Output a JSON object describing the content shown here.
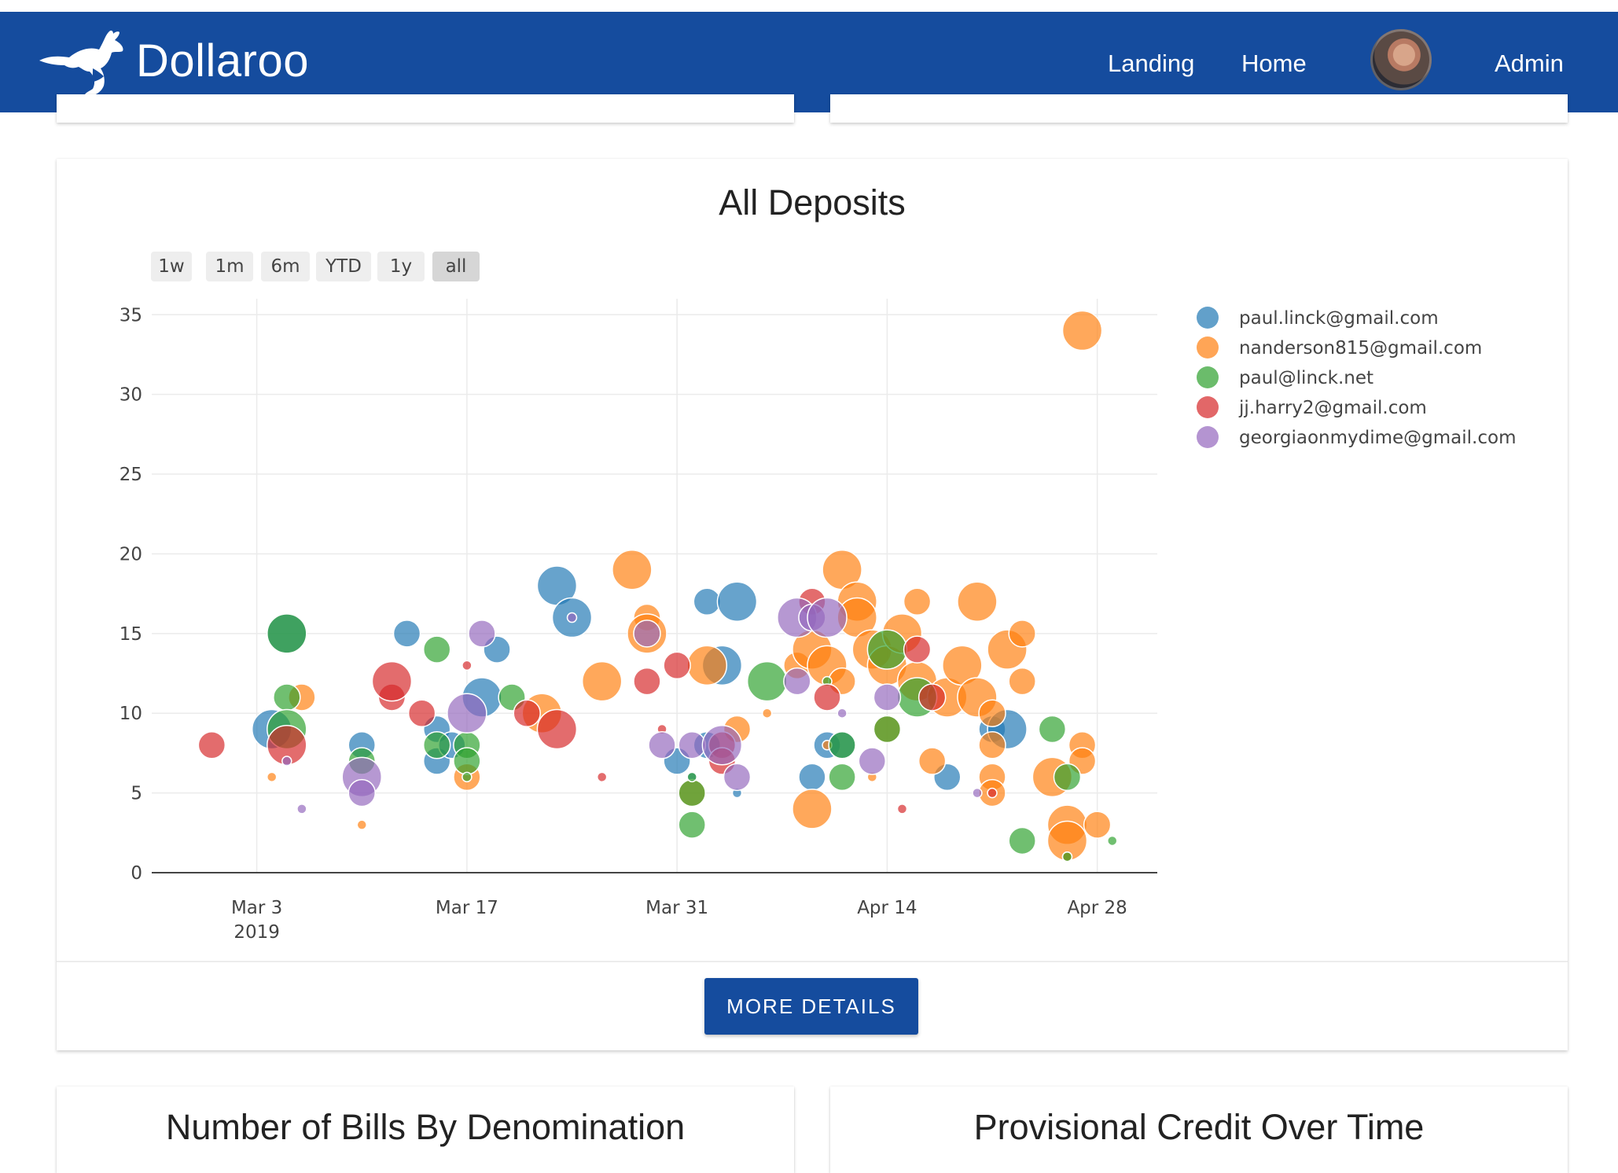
{
  "app": {
    "brand": "Dollaroo"
  },
  "nav": {
    "links": [
      "Landing",
      "Home",
      "Admin"
    ]
  },
  "main": {
    "title": "All Deposits",
    "range_buttons": [
      "1w",
      "1m",
      "6m",
      "YTD",
      "1y",
      "all"
    ],
    "active_range": "all",
    "more_details": "MORE DETAILS"
  },
  "bottom": {
    "left_title": "Number of Bills By Denomination",
    "right_title": "Provisional Credit Over Time"
  },
  "colors": {
    "navbar": "#154c9e",
    "series": [
      "#1f77b4",
      "#ff7f0e",
      "#2ca02c",
      "#d62728",
      "#9467bd"
    ]
  },
  "chart_data": {
    "type": "scatter",
    "title": "All Deposits",
    "xlabel": "",
    "ylabel": "",
    "x_range": [
      "2019-02-24",
      "2019-05-02"
    ],
    "ylim": [
      0,
      36
    ],
    "y_ticks": [
      0,
      5,
      10,
      15,
      20,
      25,
      30,
      35
    ],
    "x_ticks": [
      {
        "date": "2019-03-03",
        "label": "Mar 3",
        "sublabel": "2019"
      },
      {
        "date": "2019-03-17",
        "label": "Mar 17"
      },
      {
        "date": "2019-03-31",
        "label": "Mar 31"
      },
      {
        "date": "2019-04-14",
        "label": "Apr 14"
      },
      {
        "date": "2019-04-28",
        "label": "Apr 28"
      }
    ],
    "grid": true,
    "legend_position": "top-right",
    "series": [
      {
        "name": "paul.linck@gmail.com",
        "color": "#1f77b4",
        "points": [
          [
            "2019-03-04",
            9
          ],
          [
            "2019-03-05",
            15
          ],
          [
            "2019-03-10",
            8
          ],
          [
            "2019-03-13",
            15
          ],
          [
            "2019-03-15",
            7
          ],
          [
            "2019-03-15",
            9
          ],
          [
            "2019-03-16",
            8
          ],
          [
            "2019-03-18",
            11
          ],
          [
            "2019-03-19",
            14
          ],
          [
            "2019-03-23",
            18
          ],
          [
            "2019-03-24",
            16
          ],
          [
            "2019-03-31",
            7
          ],
          [
            "2019-04-01",
            6
          ],
          [
            "2019-04-02",
            17
          ],
          [
            "2019-04-02",
            8
          ],
          [
            "2019-04-03",
            13
          ],
          [
            "2019-04-04",
            17
          ],
          [
            "2019-04-04",
            5
          ],
          [
            "2019-04-09",
            6
          ],
          [
            "2019-04-10",
            8
          ],
          [
            "2019-04-11",
            8
          ],
          [
            "2019-04-18",
            6
          ],
          [
            "2019-04-21",
            9
          ],
          [
            "2019-04-22",
            9
          ]
        ],
        "sizes": [
          3,
          3,
          2,
          2,
          2,
          2,
          2,
          3,
          2,
          3,
          3,
          2,
          1,
          2,
          2,
          3,
          3,
          1,
          2,
          2,
          2,
          2,
          2,
          3
        ]
      },
      {
        "name": "nanderson815@gmail.com",
        "color": "#ff7f0e",
        "points": [
          [
            "2019-03-04",
            6
          ],
          [
            "2019-03-06",
            11
          ],
          [
            "2019-03-10",
            3
          ],
          [
            "2019-03-17",
            6
          ],
          [
            "2019-03-22",
            10
          ],
          [
            "2019-03-26",
            12
          ],
          [
            "2019-03-28",
            19
          ],
          [
            "2019-03-29",
            16
          ],
          [
            "2019-03-29",
            15
          ],
          [
            "2019-04-01",
            5
          ],
          [
            "2019-04-02",
            13
          ],
          [
            "2019-04-04",
            9
          ],
          [
            "2019-04-06",
            10
          ],
          [
            "2019-04-08",
            13
          ],
          [
            "2019-04-09",
            14
          ],
          [
            "2019-04-09",
            4
          ],
          [
            "2019-04-10",
            8
          ],
          [
            "2019-04-10",
            13
          ],
          [
            "2019-04-11",
            19
          ],
          [
            "2019-04-11",
            12
          ],
          [
            "2019-04-12",
            17
          ],
          [
            "2019-04-12",
            16
          ],
          [
            "2019-04-13",
            14
          ],
          [
            "2019-04-13",
            6
          ],
          [
            "2019-04-14",
            13
          ],
          [
            "2019-04-14",
            9
          ],
          [
            "2019-04-15",
            15
          ],
          [
            "2019-04-16",
            17
          ],
          [
            "2019-04-16",
            12
          ],
          [
            "2019-04-17",
            7
          ],
          [
            "2019-04-18",
            11
          ],
          [
            "2019-04-19",
            13
          ],
          [
            "2019-04-20",
            17
          ],
          [
            "2019-04-20",
            11
          ],
          [
            "2019-04-21",
            10
          ],
          [
            "2019-04-21",
            8
          ],
          [
            "2019-04-21",
            6
          ],
          [
            "2019-04-21",
            5
          ],
          [
            "2019-04-22",
            14
          ],
          [
            "2019-04-23",
            15
          ],
          [
            "2019-04-23",
            12
          ],
          [
            "2019-04-25",
            6
          ],
          [
            "2019-04-26",
            3
          ],
          [
            "2019-04-26",
            2
          ],
          [
            "2019-04-26",
            1
          ],
          [
            "2019-04-27",
            8
          ],
          [
            "2019-04-27",
            7
          ],
          [
            "2019-04-27",
            34
          ],
          [
            "2019-04-28",
            3
          ]
        ],
        "sizes": [
          1,
          2,
          1,
          2,
          3,
          3,
          3,
          2,
          3,
          2,
          3,
          2,
          1,
          2,
          3,
          3,
          1,
          3,
          3,
          2,
          3,
          3,
          3,
          1,
          3,
          2,
          3,
          2,
          3,
          2,
          3,
          3,
          3,
          3,
          2,
          2,
          2,
          2,
          3,
          2,
          2,
          3,
          3,
          3,
          1,
          2,
          2,
          3,
          2
        ]
      },
      {
        "name": "paul@linck.net",
        "color": "#2ca02c",
        "points": [
          [
            "2019-03-05",
            15
          ],
          [
            "2019-03-05",
            11
          ],
          [
            "2019-03-05",
            9
          ],
          [
            "2019-03-10",
            7
          ],
          [
            "2019-03-15",
            14
          ],
          [
            "2019-03-15",
            8
          ],
          [
            "2019-03-17",
            8
          ],
          [
            "2019-03-17",
            7
          ],
          [
            "2019-03-17",
            6
          ],
          [
            "2019-03-20",
            11
          ],
          [
            "2019-04-01",
            5
          ],
          [
            "2019-04-01",
            3
          ],
          [
            "2019-04-01",
            6
          ],
          [
            "2019-04-06",
            12
          ],
          [
            "2019-04-10",
            12
          ],
          [
            "2019-04-11",
            8
          ],
          [
            "2019-04-11",
            6
          ],
          [
            "2019-04-14",
            14
          ],
          [
            "2019-04-14",
            9
          ],
          [
            "2019-04-16",
            11
          ],
          [
            "2019-04-23",
            2
          ],
          [
            "2019-04-25",
            9
          ],
          [
            "2019-04-26",
            6
          ],
          [
            "2019-04-26",
            1
          ],
          [
            "2019-04-29",
            2
          ]
        ],
        "sizes": [
          3,
          2,
          3,
          2,
          2,
          2,
          2,
          2,
          1,
          2,
          2,
          2,
          1,
          3,
          1,
          2,
          2,
          3,
          2,
          3,
          2,
          2,
          2,
          1,
          1
        ]
      },
      {
        "name": "jj.harry2@gmail.com",
        "color": "#d62728",
        "points": [
          [
            "2019-02-28",
            8
          ],
          [
            "2019-03-05",
            8
          ],
          [
            "2019-03-12",
            11
          ],
          [
            "2019-03-12",
            12
          ],
          [
            "2019-03-14",
            10
          ],
          [
            "2019-03-17",
            13
          ],
          [
            "2019-03-21",
            10
          ],
          [
            "2019-03-23",
            9
          ],
          [
            "2019-03-26",
            6
          ],
          [
            "2019-03-29",
            12
          ],
          [
            "2019-03-30",
            9
          ],
          [
            "2019-03-31",
            13
          ],
          [
            "2019-04-03",
            8
          ],
          [
            "2019-04-03",
            7
          ],
          [
            "2019-04-09",
            17
          ],
          [
            "2019-04-10",
            11
          ],
          [
            "2019-04-15",
            4
          ],
          [
            "2019-04-16",
            14
          ],
          [
            "2019-04-17",
            11
          ],
          [
            "2019-04-21",
            5
          ]
        ],
        "sizes": [
          2,
          3,
          2,
          3,
          2,
          1,
          2,
          3,
          1,
          2,
          1,
          2,
          2,
          2,
          2,
          2,
          1,
          2,
          2,
          1
        ]
      },
      {
        "name": "georgiaonmydime@gmail.com",
        "color": "#9467bd",
        "points": [
          [
            "2019-03-05",
            7
          ],
          [
            "2019-03-06",
            4
          ],
          [
            "2019-03-10",
            6
          ],
          [
            "2019-03-10",
            5
          ],
          [
            "2019-03-17",
            10
          ],
          [
            "2019-03-18",
            15
          ],
          [
            "2019-03-24",
            16
          ],
          [
            "2019-03-29",
            15
          ],
          [
            "2019-03-30",
            8
          ],
          [
            "2019-04-01",
            8
          ],
          [
            "2019-04-03",
            8
          ],
          [
            "2019-04-04",
            6
          ],
          [
            "2019-04-08",
            12
          ],
          [
            "2019-04-08",
            16
          ],
          [
            "2019-04-09",
            16
          ],
          [
            "2019-04-10",
            16
          ],
          [
            "2019-04-11",
            10
          ],
          [
            "2019-04-13",
            7
          ],
          [
            "2019-04-14",
            11
          ],
          [
            "2019-04-20",
            5
          ]
        ],
        "sizes": [
          1,
          1,
          3,
          2,
          3,
          2,
          1,
          2,
          2,
          2,
          3,
          2,
          2,
          3,
          2,
          3,
          1,
          2,
          2,
          1
        ]
      }
    ]
  }
}
